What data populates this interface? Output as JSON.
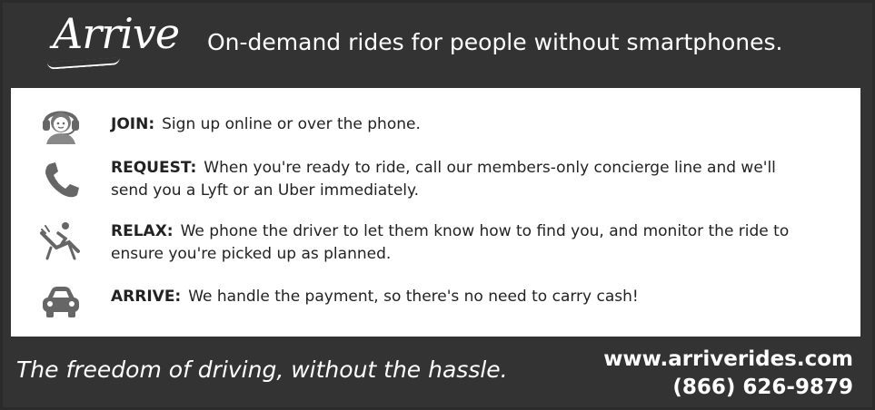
{
  "header": {
    "logo_text": "Arrive",
    "tagline": "On-demand rides for people without smartphones."
  },
  "steps": [
    {
      "icon": "headset-operator-icon",
      "key": "JOIN:",
      "text": "Sign up online or over the phone."
    },
    {
      "icon": "phone-icon",
      "key": "REQUEST:",
      "text": "When you're ready to ride, call our members-only concierge line and we'll send you a Lyft or an Uber immediately."
    },
    {
      "icon": "lounge-chair-icon",
      "key": "RELAX:",
      "text": "We phone the driver to let them know how to find you, and monitor the ride to ensure you're picked up as planned."
    },
    {
      "icon": "car-icon",
      "key": "ARRIVE:",
      "text": "We handle the payment, so there's no need to carry cash!"
    }
  ],
  "footer": {
    "slogan": "The freedom of driving, without the hassle.",
    "website": "www.arriverides.com",
    "phone": "(866) 626-9879"
  },
  "colors": {
    "background": "#333333",
    "panel": "#ffffff",
    "text": "#222222",
    "icon": "#666666"
  }
}
